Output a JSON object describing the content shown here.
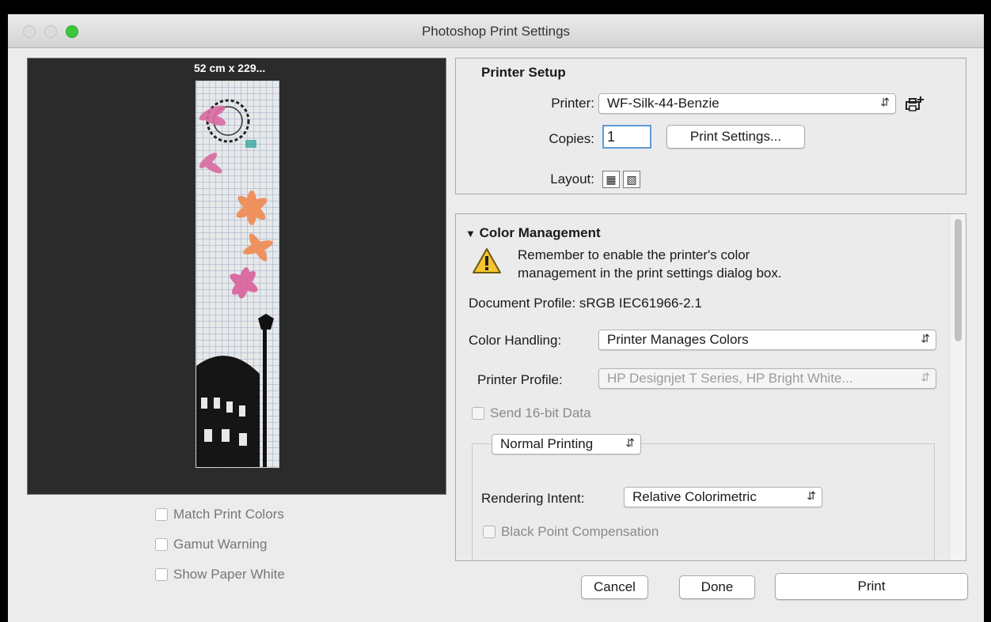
{
  "window": {
    "title": "Photoshop Print Settings"
  },
  "preview": {
    "dimensions_label": "52 cm x 229...",
    "options": [
      {
        "label": "Match Print Colors",
        "checked": false
      },
      {
        "label": "Gamut Warning",
        "checked": false
      },
      {
        "label": "Show Paper White",
        "checked": false
      }
    ]
  },
  "printer_setup": {
    "heading": "Printer Setup",
    "printer_label": "Printer:",
    "printer_value": "WF-Silk-44-Benzie",
    "copies_label": "Copies:",
    "copies_value": "1",
    "print_settings_button": "Print Settings...",
    "layout_label": "Layout:"
  },
  "color_management": {
    "heading": "Color Management",
    "warning_line1": "Remember to enable the printer's color",
    "warning_line2": "management in the print settings dialog box.",
    "document_profile": "Document Profile: sRGB IEC61966-2.1",
    "color_handling_label": "Color Handling:",
    "color_handling_value": "Printer Manages Colors",
    "printer_profile_label": "Printer Profile:",
    "printer_profile_value": "HP Designjet T Series, HP Bright White...",
    "send16_label": "Send 16-bit Data",
    "printing_mode_value": "Normal Printing",
    "rendering_intent_label": "Rendering Intent:",
    "rendering_intent_value": "Relative Colorimetric",
    "black_point_label": "Black Point Compensation"
  },
  "buttons": {
    "cancel": "Cancel",
    "done": "Done",
    "print": "Print"
  },
  "colors": {
    "accent_focus": "#5e9bd6",
    "zoom_green": "#3cc63c"
  }
}
